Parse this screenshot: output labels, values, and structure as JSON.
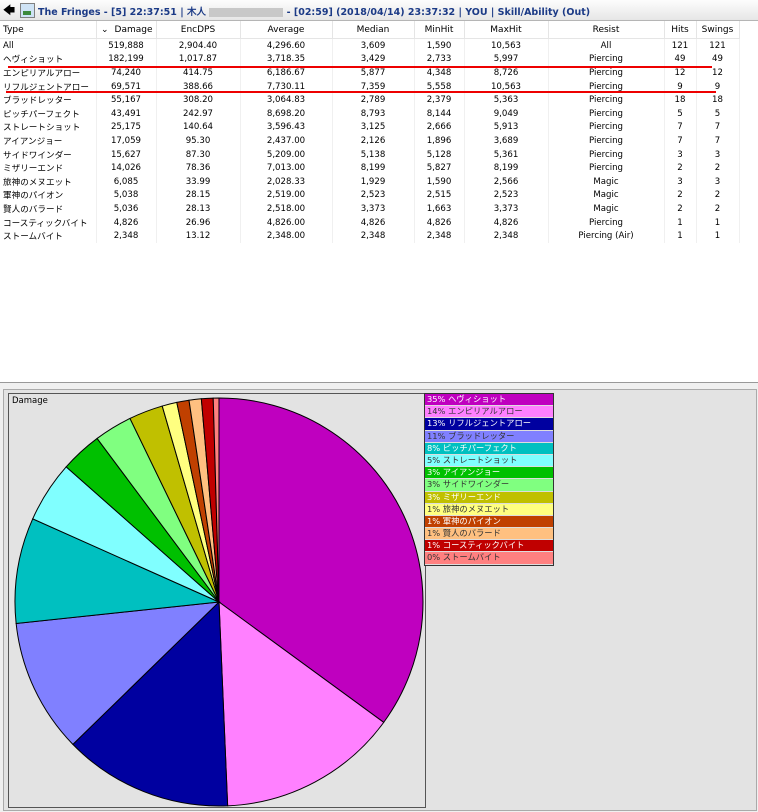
{
  "title": {
    "app": "The Fringes",
    "part1": " - [5] 22:37:51 | 木人",
    "part2": " - [02:59] (2018/04/14) 23:37:32 | YOU | Skill/Ability (Out)"
  },
  "table": {
    "sort_arrow": "⌄",
    "columns": [
      "Type",
      "Damage",
      "EncDPS",
      "Average",
      "Median",
      "MinHit",
      "MaxHit",
      "Resist",
      "Hits",
      "Swings"
    ],
    "rows": [
      [
        "All",
        "519,888",
        "2,904.40",
        "4,296.60",
        "3,609",
        "1,590",
        "10,563",
        "All",
        "121",
        "121"
      ],
      [
        "ヘヴィショット",
        "182,199",
        "1,017.87",
        "3,718.35",
        "3,429",
        "2,733",
        "5,997",
        "Piercing",
        "49",
        "49"
      ],
      [
        "エンピリアルアロー",
        "74,240",
        "414.75",
        "6,186.67",
        "5,877",
        "4,348",
        "8,726",
        "Piercing",
        "12",
        "12"
      ],
      [
        "リフルジェントアロー",
        "69,571",
        "388.66",
        "7,730.11",
        "7,359",
        "5,558",
        "10,563",
        "Piercing",
        "9",
        "9"
      ],
      [
        "ブラッドレッター",
        "55,167",
        "308.20",
        "3,064.83",
        "2,789",
        "2,379",
        "5,363",
        "Piercing",
        "18",
        "18"
      ],
      [
        "ピッチパーフェクト",
        "43,491",
        "242.97",
        "8,698.20",
        "8,793",
        "8,144",
        "9,049",
        "Piercing",
        "5",
        "5"
      ],
      [
        "ストレートショット",
        "25,175",
        "140.64",
        "3,596.43",
        "3,125",
        "2,666",
        "5,913",
        "Piercing",
        "7",
        "7"
      ],
      [
        "アイアンジョー",
        "17,059",
        "95.30",
        "2,437.00",
        "2,126",
        "1,896",
        "3,689",
        "Piercing",
        "7",
        "7"
      ],
      [
        "サイドワインダー",
        "15,627",
        "87.30",
        "5,209.00",
        "5,138",
        "5,128",
        "5,361",
        "Piercing",
        "3",
        "3"
      ],
      [
        "ミザリーエンド",
        "14,026",
        "78.36",
        "7,013.00",
        "8,199",
        "5,827",
        "8,199",
        "Piercing",
        "2",
        "2"
      ],
      [
        "旅神のメヌエット",
        "6,085",
        "33.99",
        "2,028.33",
        "1,929",
        "1,590",
        "2,566",
        "Magic",
        "3",
        "3"
      ],
      [
        "軍神のパイオン",
        "5,038",
        "28.15",
        "2,519.00",
        "2,523",
        "2,515",
        "2,523",
        "Magic",
        "2",
        "2"
      ],
      [
        "賢人のバラード",
        "5,036",
        "28.13",
        "2,518.00",
        "3,373",
        "1,663",
        "3,373",
        "Magic",
        "2",
        "2"
      ],
      [
        "コースティックバイト",
        "4,826",
        "26.96",
        "4,826.00",
        "4,826",
        "4,826",
        "4,826",
        "Piercing",
        "1",
        "1"
      ],
      [
        "ストームバイト",
        "2,348",
        "13.12",
        "2,348.00",
        "2,348",
        "2,348",
        "2,348",
        "Piercing (Air)",
        "1",
        "1"
      ]
    ]
  },
  "chart_data": {
    "type": "pie",
    "title": "Damage",
    "slices": [
      {
        "label": "35% ヘヴィショット",
        "value": 182199,
        "color": "#bf00bf"
      },
      {
        "label": "14% エンピリアルアロー",
        "value": 74240,
        "color": "#ff80ff"
      },
      {
        "label": "13% リフルジェントアロー",
        "value": 69571,
        "color": "#0000a0"
      },
      {
        "label": "11% ブラッドレッター",
        "value": 55167,
        "color": "#8080ff"
      },
      {
        "label": "8% ピッチパーフェクト",
        "value": 43491,
        "color": "#00c0c0"
      },
      {
        "label": "5% ストレートショット",
        "value": 25175,
        "color": "#80ffff"
      },
      {
        "label": "3% アイアンジョー",
        "value": 17059,
        "color": "#00c000"
      },
      {
        "label": "3% サイドワインダー",
        "value": 15627,
        "color": "#80ff80"
      },
      {
        "label": "3% ミザリーエンド",
        "value": 14026,
        "color": "#c0c000"
      },
      {
        "label": "1% 旅神のメヌエット",
        "value": 6085,
        "color": "#ffff80"
      },
      {
        "label": "1% 軍神のパイオン",
        "value": 5038,
        "color": "#c04000"
      },
      {
        "label": "1% 賢人のバラード",
        "value": 5036,
        "color": "#ffc080"
      },
      {
        "label": "1% コースティックバイト",
        "value": 4826,
        "color": "#c00000"
      },
      {
        "label": "0% ストームバイト",
        "value": 2348,
        "color": "#ff8080"
      }
    ],
    "legend": "right"
  }
}
